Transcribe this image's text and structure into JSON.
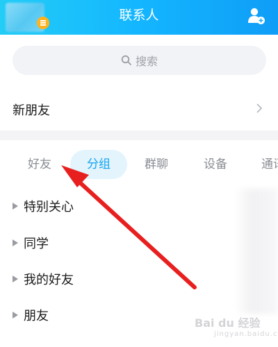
{
  "header": {
    "title": "联系人",
    "left_avatar_icon": "profile-avatar",
    "right_icon": "add-friend-icon",
    "gradient": [
      "#22cdf6",
      "#0f9df7"
    ]
  },
  "search": {
    "label": "搜索",
    "icon": "search-icon"
  },
  "new_friends": {
    "label": "新朋友",
    "icon": "chevron-right-icon"
  },
  "tabs": [
    {
      "label": "好友",
      "active": false
    },
    {
      "label": "分组",
      "active": true
    },
    {
      "label": "群聊",
      "active": false
    },
    {
      "label": "设备",
      "active": false
    },
    {
      "label": "通讯",
      "active": false
    }
  ],
  "groups": [
    {
      "label": "特别关心",
      "icon": "caret-right-icon"
    },
    {
      "label": "同学",
      "icon": "caret-right-icon"
    },
    {
      "label": "我的好友",
      "icon": "caret-right-icon"
    },
    {
      "label": "朋友",
      "icon": "caret-right-icon"
    }
  ],
  "annotation": {
    "type": "red-arrow",
    "color": "#e81f1f",
    "points_to": "好友"
  },
  "watermark": {
    "brand": "Bai du 经验",
    "sub": "jingyan.baidu.com"
  },
  "colors": {
    "accent": "#11a3f1",
    "active_tab_bg": "#e3f4fd",
    "search_bg": "#f2f3f7",
    "divider_bg": "#f4f4f7"
  }
}
